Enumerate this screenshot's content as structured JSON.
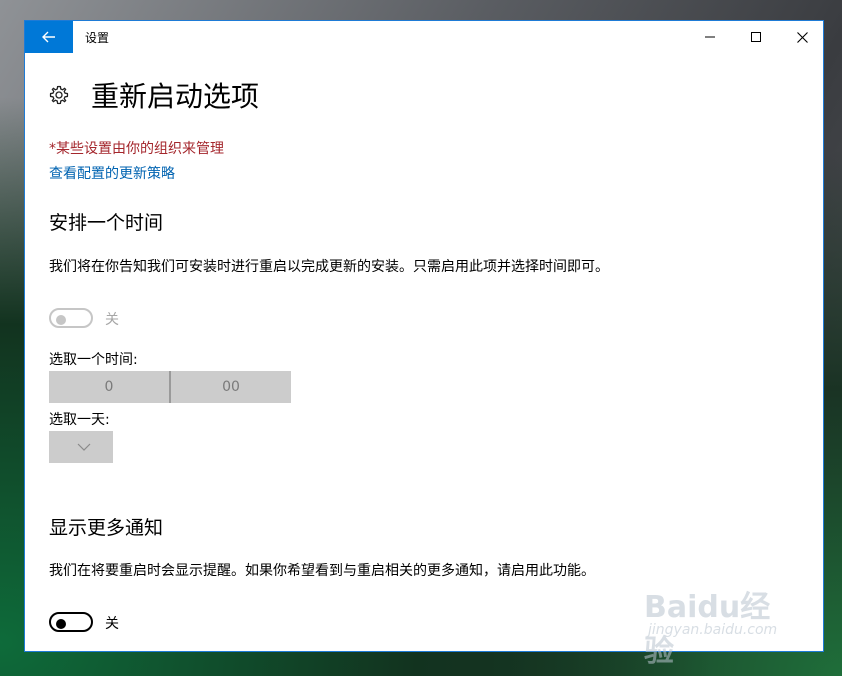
{
  "window": {
    "title": "设置"
  },
  "page": {
    "title": "重新启动选项",
    "org_note": "*某些设置由你的组织来管理",
    "policy_link": "查看配置的更新策略"
  },
  "schedule": {
    "title": "安排一个时间",
    "description": "我们将在你告知我们可安装时进行重启以完成更新的安装。只需启用此项并选择时间即可。",
    "toggle_state": "关",
    "time_label": "选取一个时间:",
    "hour": "0",
    "minute": "00",
    "day_label": "选取一天:"
  },
  "notifications": {
    "title": "显示更多通知",
    "description": "我们在将要重启时会显示提醒。如果你希望看到与重启相关的更多通知，请启用此功能。",
    "toggle_state": "关"
  },
  "watermark": {
    "logo": "Baidu经验",
    "sub": "jingyan.baidu.com"
  },
  "colors": {
    "accent": "#0078d7",
    "warning": "#a4262c",
    "link": "#0063b1",
    "disabled": "#c6c6c6"
  },
  "icons": [
    "back-arrow-icon",
    "minimize-icon",
    "maximize-icon",
    "close-icon",
    "gear-icon",
    "chevron-down-icon"
  ]
}
